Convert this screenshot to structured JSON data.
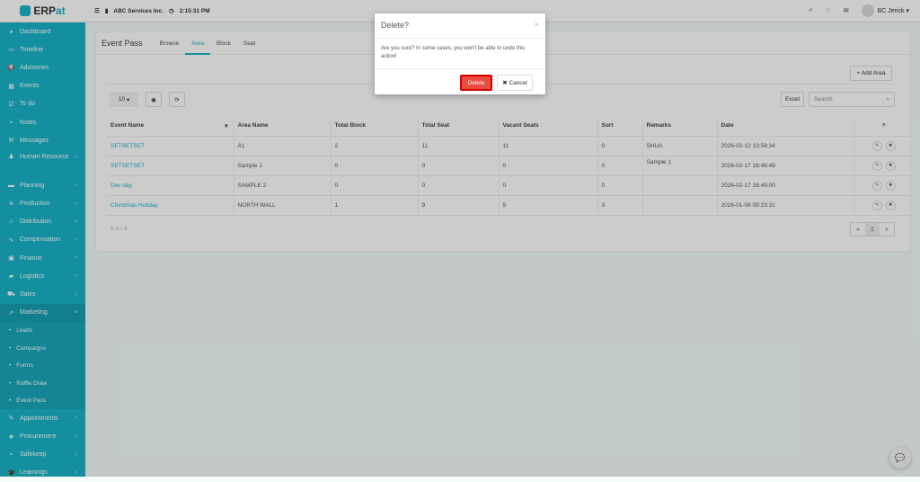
{
  "app": {
    "logo_text_1": "ERP",
    "logo_text_2": "at",
    "company": "ABC Services Inc.",
    "time": "2:15:31 PM",
    "user": "BC Jerick"
  },
  "sidebar": {
    "items": [
      {
        "label": "Dashboard",
        "icon": "dashboard-icon",
        "glyph": "◕"
      },
      {
        "label": "Timeline",
        "icon": "timeline-icon",
        "glyph": "▭"
      },
      {
        "label": "Advisories",
        "icon": "megaphone-icon",
        "glyph": "📢"
      },
      {
        "label": "Events",
        "icon": "calendar-icon",
        "glyph": "▦"
      },
      {
        "label": "To do",
        "icon": "checkbox-icon",
        "glyph": "☑"
      },
      {
        "label": "Notes",
        "icon": "notes-icon",
        "glyph": "▪"
      },
      {
        "label": "Messages",
        "icon": "envelope-icon",
        "glyph": "✉"
      },
      {
        "label": "Human Resource",
        "icon": "users-icon",
        "glyph": "♟"
      },
      {
        "label": "Planning",
        "icon": "briefcase-icon",
        "glyph": "▬"
      },
      {
        "label": "Production",
        "icon": "production-icon",
        "glyph": "⚘"
      },
      {
        "label": "Distribution",
        "icon": "bank-icon",
        "glyph": "⌂"
      },
      {
        "label": "Compensation",
        "icon": "compensation-icon",
        "glyph": "∿"
      },
      {
        "label": "Finance",
        "icon": "money-icon",
        "glyph": "▣"
      },
      {
        "label": "Logistics",
        "icon": "truck-icon",
        "glyph": "▰"
      },
      {
        "label": "Sales",
        "icon": "cart-icon",
        "glyph": "⛟"
      },
      {
        "label": "Marketing",
        "icon": "chart-icon",
        "glyph": "↗"
      },
      {
        "label": "Appointments",
        "icon": "edit-icon",
        "glyph": "✎"
      },
      {
        "label": "Procurement",
        "icon": "cubes-icon",
        "glyph": "❖"
      },
      {
        "label": "Safekeep",
        "icon": "safe-icon",
        "glyph": "▪"
      },
      {
        "label": "Learnings",
        "icon": "graduation-cap-icon",
        "glyph": "🎓"
      }
    ],
    "marketing_sub": [
      "Leads",
      "Campaigns",
      "Forms",
      "Raffle Draw",
      "Event Pass"
    ]
  },
  "page": {
    "title": "Event Pass",
    "tabs": [
      "Browse",
      "Area",
      "Block",
      "Seat"
    ],
    "add_button": "+ Add Area",
    "page_size": "10",
    "excel": "Excel",
    "search_placeholder": "Search",
    "summary": "1-4 / 4",
    "current_page": "1"
  },
  "table": {
    "headers": [
      "Event Name",
      "Area Name",
      "Total Block",
      "Total Seat",
      "Vacant Seats",
      "Sort",
      "Remarks",
      "Date"
    ],
    "rows": [
      [
        "SETSETSET",
        "A1",
        "2",
        "11",
        "11",
        "0",
        "SHUA",
        "2026-02-12 13:58:34"
      ],
      [
        "SETSETSET",
        "Sample 1",
        "0",
        "0",
        "0",
        "0",
        "Sample 1",
        "2026-02-17 16:46:49"
      ],
      [
        "Dev day",
        "SAMPLE 2",
        "0",
        "0",
        "0",
        "0",
        "",
        "2026-02-17 16:49:00"
      ],
      [
        "Chirstmas Holiday",
        "NORTH WALL",
        "1",
        "9",
        "9",
        "3",
        "",
        "2026-01-08 09:23:31"
      ]
    ]
  },
  "modal": {
    "title": "Delete?",
    "message": "Are you sure? In some cases, you won't be able to undo this action!",
    "delete": "Delete",
    "cancel": "✖ Cancel"
  }
}
